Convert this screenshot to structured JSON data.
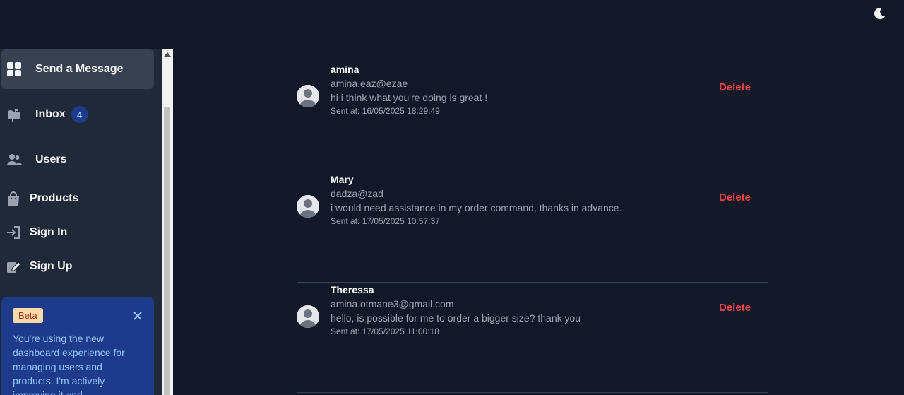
{
  "sidebar": {
    "items": [
      {
        "label": "Send a Message",
        "icon": "grid-icon"
      },
      {
        "label": "Inbox",
        "icon": "mailbox-icon",
        "badge": "4"
      },
      {
        "label": "Users",
        "icon": "users-icon"
      },
      {
        "label": "Products",
        "icon": "shopping-bag-icon"
      },
      {
        "label": "Sign In",
        "icon": "sign-in-icon"
      },
      {
        "label": "Sign Up",
        "icon": "sign-up-icon"
      }
    ],
    "beta": {
      "badge": "Beta",
      "text": "You're using the new dashboard experience for managing users and products. I'm actively improving it and"
    }
  },
  "messages": [
    {
      "name": "amina",
      "email": "amina.eaz@ezae",
      "text": "hi i think what you're doing is great !",
      "sent_at": "Sent at: 16/05/2025 18:29:49",
      "delete_label": "Delete"
    },
    {
      "name": "Mary",
      "email": "dadza@zad",
      "text": "i would need assistance in my order command, thanks in advance.",
      "sent_at": "Sent at: 17/05/2025 10:57:37",
      "delete_label": "Delete"
    },
    {
      "name": "Theressa",
      "email": "amina.otmane3@gmail.com",
      "text": "hello, is possible for me to order a bigger size? thank you",
      "sent_at": "Sent at: 17/05/2025 11:00:18",
      "delete_label": "Delete"
    }
  ],
  "colors": {
    "background": "#111827",
    "sidebar": "#1f2937",
    "delete": "#ef4444",
    "beta_card": "#1e3a8a"
  }
}
